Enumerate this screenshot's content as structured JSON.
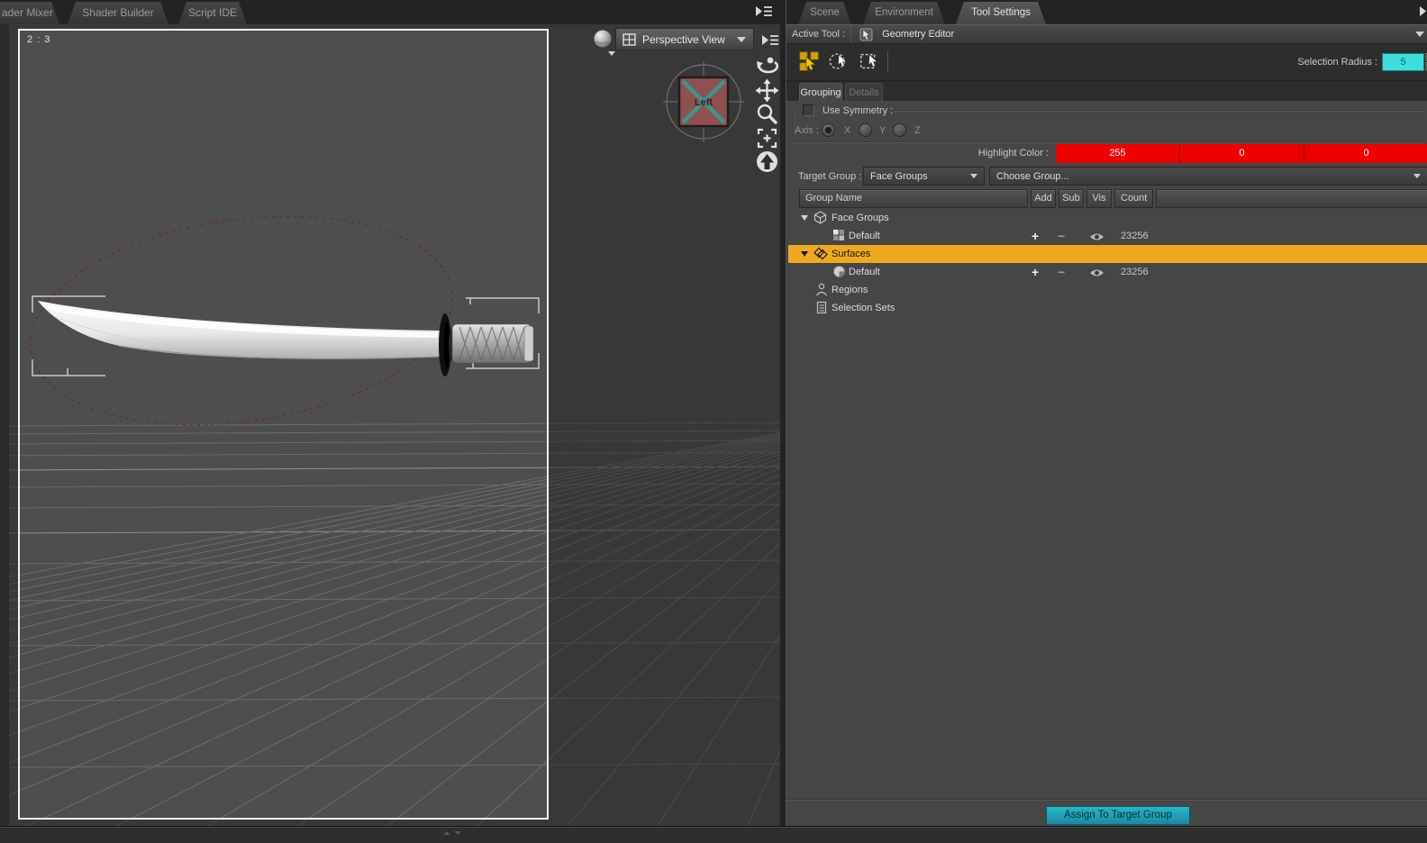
{
  "left_tabs": {
    "items": [
      {
        "label": "ader Mixer"
      },
      {
        "label": "Shader Builder"
      },
      {
        "label": "Script IDE"
      }
    ]
  },
  "viewport": {
    "aspect_label": "2 : 3",
    "view_selector": "Perspective View",
    "nav_cube_face": "Left"
  },
  "right_tabs": {
    "items": [
      {
        "label": "Scene"
      },
      {
        "label": "Environment"
      },
      {
        "label": "Tool Settings"
      }
    ]
  },
  "tool_settings": {
    "active_tool_label": "Active Tool :",
    "active_tool_name": "Geometry Editor",
    "selection_radius_label": "Selection Radius :",
    "selection_radius_value": "5",
    "tabs": {
      "grouping": "Grouping",
      "details": "Details"
    },
    "use_symmetry_label": "Use Symmetry :",
    "axis_label": "Axis :",
    "axis_options": [
      {
        "label": "X"
      },
      {
        "label": "Y"
      },
      {
        "label": "Z"
      }
    ],
    "highlight_color_label": "Highlight Color :",
    "highlight_color": {
      "r": "255",
      "g": "0",
      "b": "0",
      "hex": "#ee0000"
    },
    "target_group_label": "Target Group :",
    "target_group_value": "Face Groups",
    "choose_group_value": "Choose Group...",
    "table": {
      "columns": [
        "Group Name",
        "Add",
        "Sub",
        "Vis",
        "Count"
      ]
    },
    "tree": {
      "add_symbol": "+",
      "sub_symbol": "−",
      "highlight_row_color": "#efa91e",
      "rows": [
        {
          "label": "Face Groups"
        },
        {
          "label": "Default",
          "count": "23256"
        },
        {
          "label": "Surfaces"
        },
        {
          "label": "Default",
          "count": "23256"
        },
        {
          "label": "Regions"
        },
        {
          "label": "Selection Sets"
        }
      ]
    },
    "assign_button_label": "Assign To Target Group",
    "accent_cyan": "#3fdede",
    "button_teal": "#1d9fb5"
  }
}
